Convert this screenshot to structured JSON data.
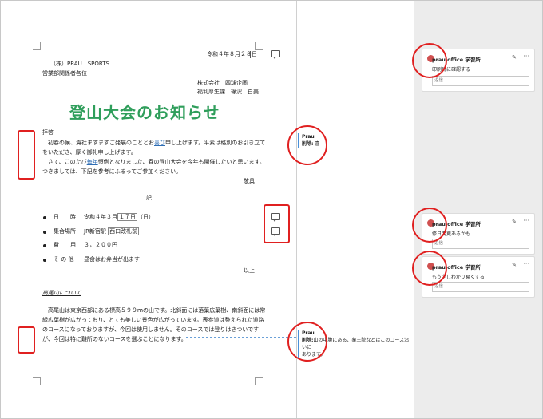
{
  "document": {
    "date": "令和４年８月２８日",
    "recipient_company": "（株）PRAU　SPORTS",
    "recipient_dept": "営業部関係者各位",
    "sender_company": "株式会社　四球企画",
    "sender_person": "福利厚生課　篠沢　白美",
    "title": "登山大会のお知らせ",
    "greeting": "拝啓",
    "body_lines": [
      {
        "a": "　初春の候、貴社ますますご発展のこととお",
        "mark": "喜び",
        "b": "申し上げます。平素は格別のお引き立て"
      },
      {
        "a": "をいただき、厚く御礼申し上げます。",
        "mark": "",
        "b": ""
      },
      {
        "a": "　さて、このたび",
        "mark": "毎年",
        "b": "恒例となりました、春の登山大会を今年も開催したいと思います。"
      },
      {
        "a": "つきましては、下記を参考にふるってご参加ください。",
        "mark": "",
        "b": ""
      }
    ],
    "keigu": "敬具",
    "ki": "記",
    "items": [
      {
        "label": "日　　時",
        "value_pre": "令和４年３月",
        "value_box": "１７日",
        "value_post": "（日）"
      },
      {
        "label": "集合場所",
        "value_pre": "JR新宿駅",
        "value_box": "西口改札前",
        "value_post": ""
      },
      {
        "label": "費　　用",
        "value_pre": "３，２００円",
        "value_box": "",
        "value_post": ""
      },
      {
        "label": "そ の 他",
        "value_pre": "昼食はお弁当が出ます",
        "value_box": "",
        "value_post": ""
      }
    ],
    "ijou": "以上",
    "section_heading": "高尾山について",
    "section_lines": [
      "　高尾山は東京西部にある標高５９９ｍの山です。北斜面には落葉広葉樹、南斜面には常",
      "緑広葉樹が広がっており、とても美しい景色が広がっています。表参道は整えられた道路",
      "のコースになっておりますが、今回は使用しません。そのコースでは登りはきついです",
      "が、今回は特に難所のないコースを選ぶことになります。"
    ]
  },
  "markup": {
    "balloon1": {
      "author": "Prau",
      "label": "削除:",
      "text": "喜"
    },
    "balloon2": {
      "author": "Prau",
      "label": "削除:",
      "text": "山の中腹にある、薬王院などはこのコース沿いに",
      "text2": "あります。"
    }
  },
  "comments": [
    {
      "author": "prau office 学習所",
      "text": "印刷時に確認する",
      "reply_placeholder": "返信"
    },
    {
      "author": "prau office 学習所",
      "text": "修日変更あるかも",
      "reply_placeholder": "返信"
    },
    {
      "author": "prau office 学習所",
      "text": "もう少しわかり易くする",
      "reply_placeholder": "返信"
    }
  ],
  "colors": {
    "title_green": "#2f9e5b",
    "annotation_red": "#e02020",
    "track_blue": "#4a90d9"
  },
  "icons": [
    "comment-icon",
    "edit-icon",
    "more-icon",
    "avatar-icon"
  ]
}
